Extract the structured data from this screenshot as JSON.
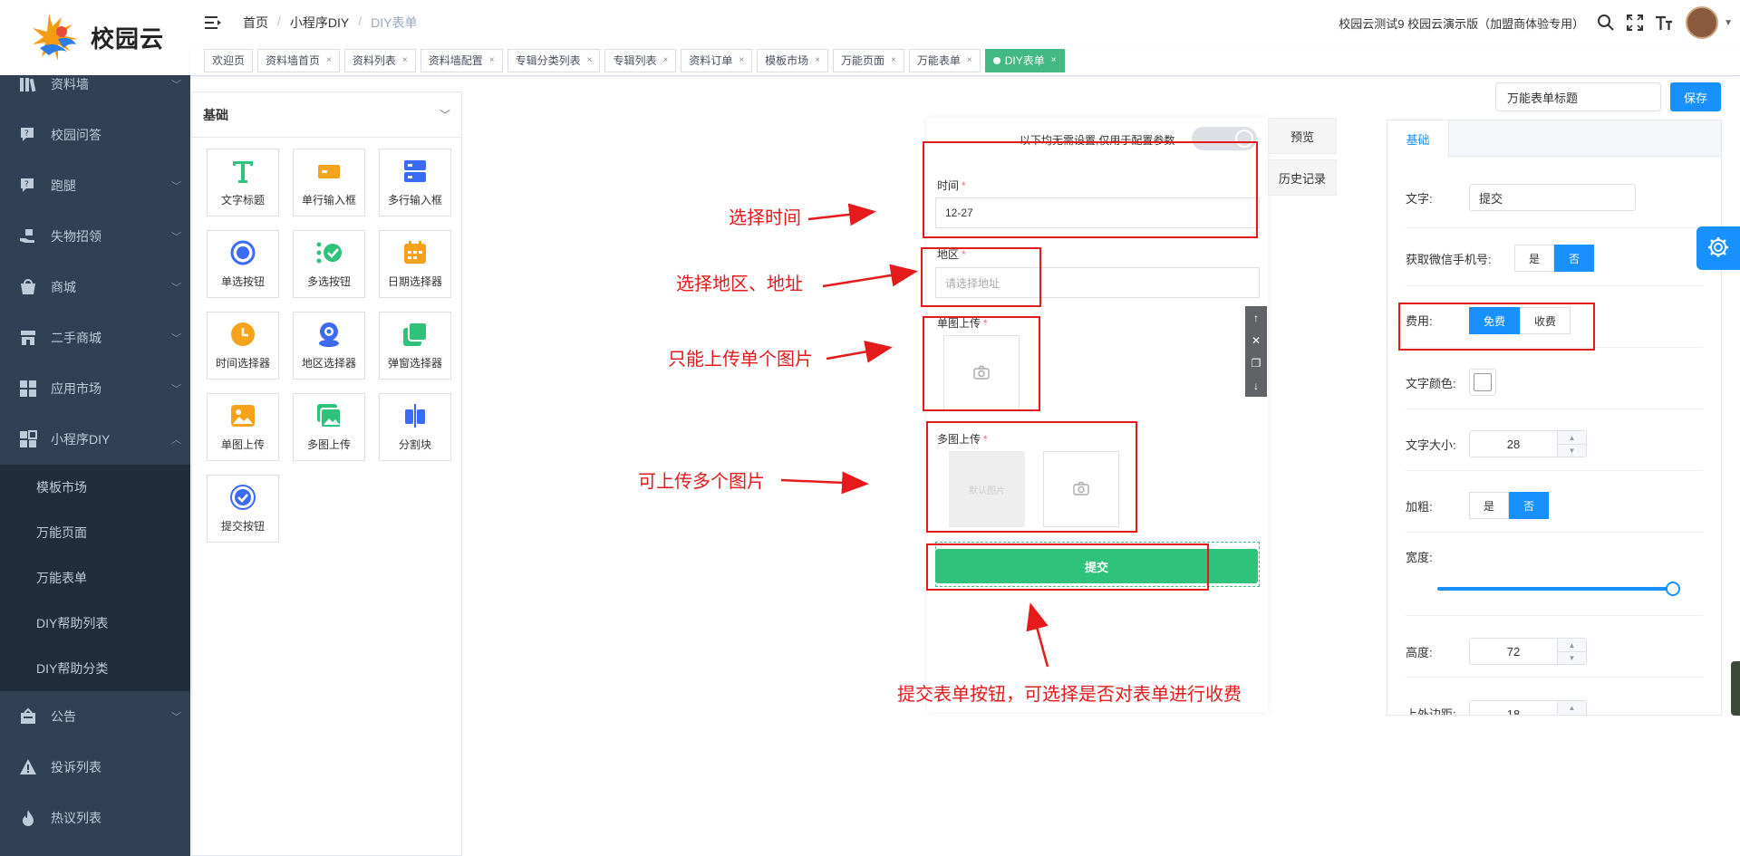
{
  "app": {
    "logo_text": "校园云"
  },
  "sidebar": {
    "items": [
      {
        "label": "资料墙",
        "icon": "books-icon",
        "expandable": true
      },
      {
        "label": "校园问答",
        "icon": "question-bubble-icon",
        "expandable": false
      },
      {
        "label": "跑腿",
        "icon": "question-bubble-icon",
        "expandable": true
      },
      {
        "label": "失物招领",
        "icon": "hand-box-icon",
        "expandable": true
      },
      {
        "label": "商城",
        "icon": "shop-bag-icon",
        "expandable": true
      },
      {
        "label": "二手商城",
        "icon": "store-icon",
        "expandable": true
      },
      {
        "label": "应用市场",
        "icon": "apps-grid-icon",
        "expandable": true
      },
      {
        "label": "小程序DIY",
        "icon": "apps-grid-icon",
        "expandable": true,
        "open": true
      }
    ],
    "sub_items": [
      "模板市场",
      "万能页面",
      "万能表单",
      "DIY帮助列表",
      "DIY帮助分类"
    ],
    "bottom_items": [
      {
        "label": "公告",
        "icon": "notice-icon",
        "expandable": true
      },
      {
        "label": "投诉列表",
        "icon": "warning-icon",
        "expandable": false
      },
      {
        "label": "热议列表",
        "icon": "flame-icon",
        "expandable": false
      }
    ]
  },
  "breadcrumb": [
    "首页",
    "小程序DIY",
    "DIY表单"
  ],
  "header": {
    "org": "校园云测试9 校园云演示版（加盟商体验专用）"
  },
  "tags": [
    {
      "label": "欢迎页",
      "closable": false
    },
    {
      "label": "资料墙首页",
      "closable": true
    },
    {
      "label": "资料列表",
      "closable": true
    },
    {
      "label": "资料墙配置",
      "closable": true
    },
    {
      "label": "专辑分类列表",
      "closable": true
    },
    {
      "label": "专辑列表",
      "closable": true
    },
    {
      "label": "资料订单",
      "closable": true
    },
    {
      "label": "模板市场",
      "closable": true
    },
    {
      "label": "万能页面",
      "closable": true
    },
    {
      "label": "万能表单",
      "closable": true
    },
    {
      "label": "DIY表单",
      "closable": true,
      "active": true
    }
  ],
  "components": {
    "header": "基础",
    "items": [
      {
        "label": "文字标题",
        "icon": "text-t-icon"
      },
      {
        "label": "单行输入框",
        "icon": "single-input-icon"
      },
      {
        "label": "多行输入框",
        "icon": "multi-input-icon"
      },
      {
        "label": "单选按钮",
        "icon": "radio-icon"
      },
      {
        "label": "多选按钮",
        "icon": "checkbox-icon"
      },
      {
        "label": "日期选择器",
        "icon": "calendar-icon"
      },
      {
        "label": "时间选择器",
        "icon": "clock-icon"
      },
      {
        "label": "地区选择器",
        "icon": "location-icon"
      },
      {
        "label": "弹窗选择器",
        "icon": "popup-icon"
      },
      {
        "label": "单图上传",
        "icon": "image-icon"
      },
      {
        "label": "多图上传",
        "icon": "images-icon"
      },
      {
        "label": "分割块",
        "icon": "divider-icon"
      },
      {
        "label": "提交按钮",
        "icon": "submit-check-icon"
      }
    ]
  },
  "canvas": {
    "tip": "以下均无需设置,仅用于配置参数",
    "time_label": "时间",
    "time_value": "12-27",
    "region_label": "地区",
    "region_placeholder": "请选择地址",
    "single_upload_label": "单图上传",
    "multi_upload_label": "多图上传",
    "default_image_text": "默认图片",
    "submit_label": "提交",
    "required_mark": "*"
  },
  "side_buttons": {
    "preview": "预览",
    "history": "历史记录"
  },
  "form_title": {
    "value": "万能表单标题",
    "save": "保存"
  },
  "props": {
    "tab": "基础",
    "text_label": "文字:",
    "text_value": "提交",
    "wx_phone_label": "获取微信手机号:",
    "yes": "是",
    "no": "否",
    "fee_label": "费用:",
    "fee_free": "免费",
    "fee_paid": "收费",
    "text_color_label": "文字颜色:",
    "font_size_label": "文字大小:",
    "font_size_value": "28",
    "bold_label": "加粗:",
    "width_label": "宽度:",
    "width_value": 1.0,
    "height_label": "高度:",
    "height_value": "72",
    "margin_label": "上外边距:",
    "margin_value": "18"
  },
  "annotations": {
    "time": "选择时间",
    "region": "选择地区、地址",
    "single": "只能上传单个图片",
    "multi": "可上传多个图片",
    "submit": "提交表单按钮，可选择是否对表单进行收费"
  },
  "colors": {
    "accent": "#1890ff",
    "green": "#2fc27a",
    "annotation": "#e51b1b",
    "sidebar": "#304156"
  }
}
